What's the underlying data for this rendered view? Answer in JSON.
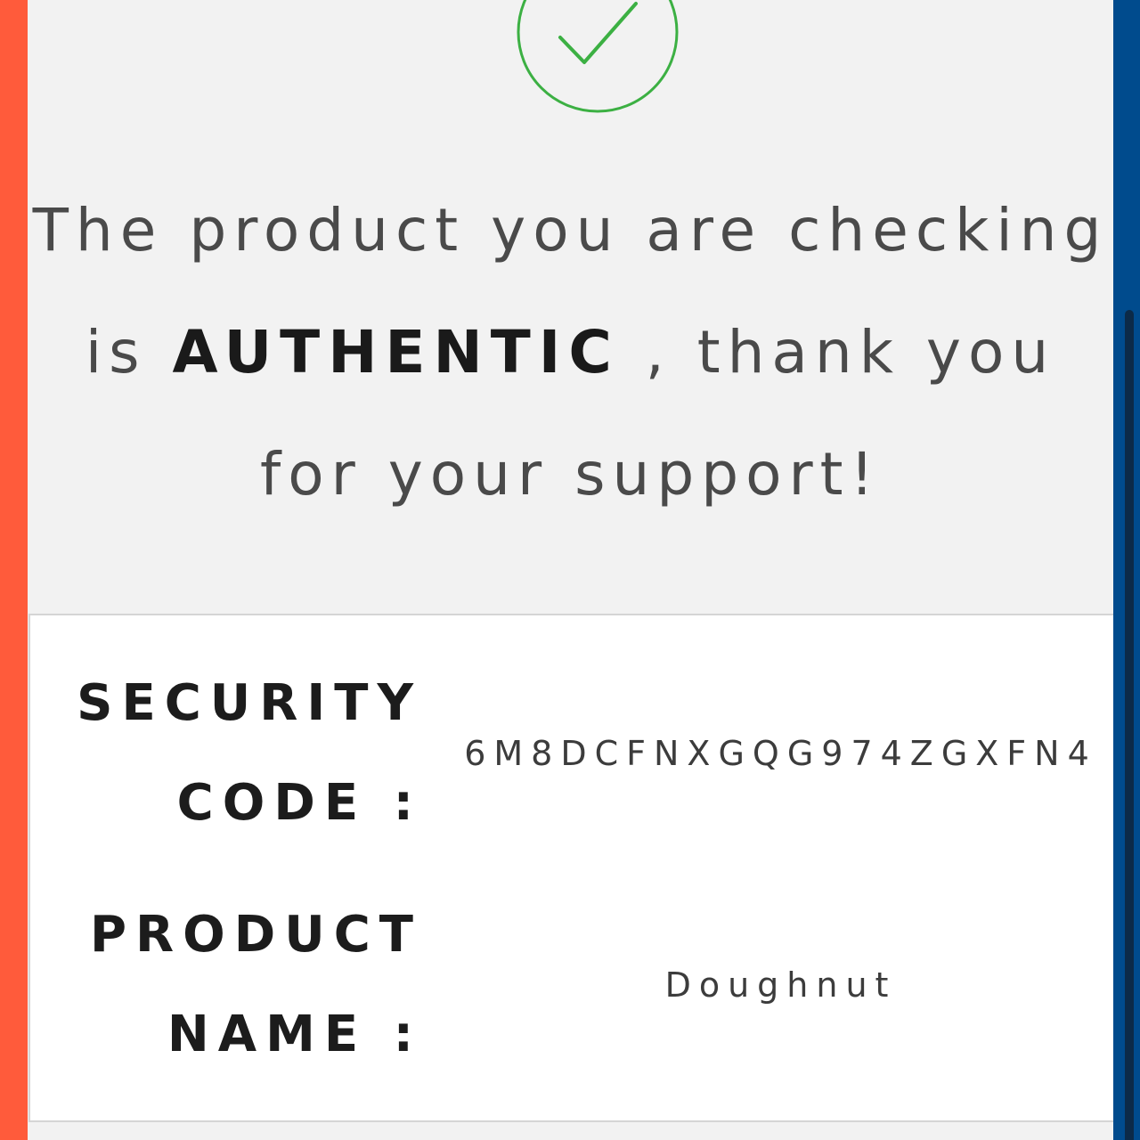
{
  "message": {
    "part1": "The product you are checking is",
    "highlight": "AUTHENTIC",
    "part2": ", thank you for your support!"
  },
  "details": {
    "security_code_label": "SECURITY CODE :",
    "security_code_value": "6M8DCFNXGQG974ZGXFN4",
    "product_name_label": "PRODUCT NAME :",
    "product_name_value": "Doughnut"
  },
  "icons": {
    "status": "check-circle-icon"
  },
  "colors": {
    "success": "#3cb043",
    "left_accent": "#ff5b3b",
    "right_accent": "#004b8d"
  }
}
